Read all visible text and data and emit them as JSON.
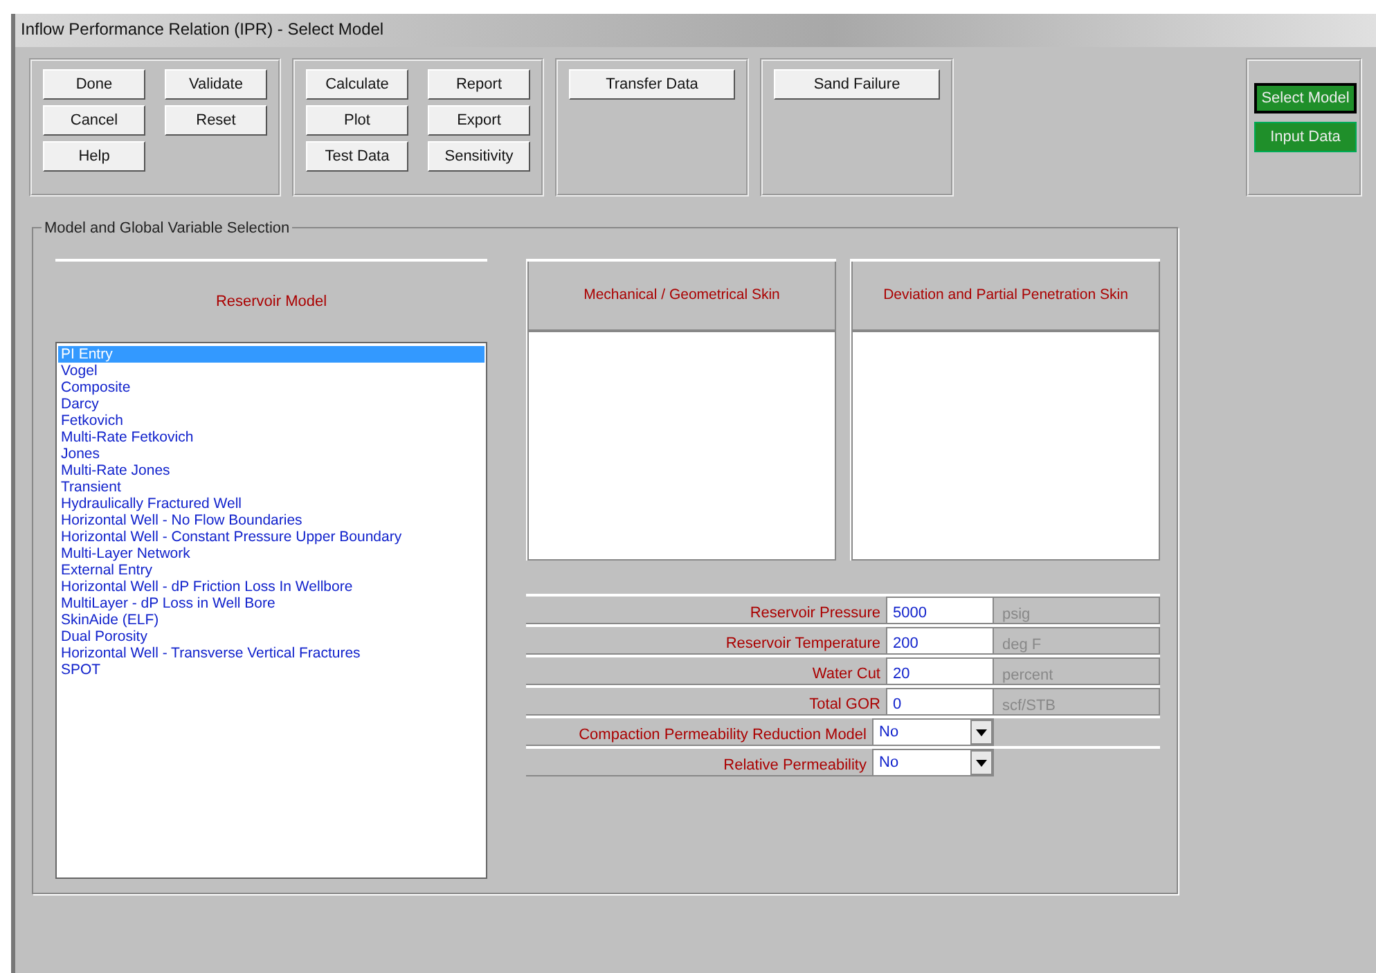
{
  "window": {
    "title": "Inflow Performance Relation (IPR) - Select Model"
  },
  "toolbar_groups": [
    {
      "buttons": [
        "Done",
        "Validate",
        "Cancel",
        "Reset",
        "Help"
      ]
    },
    {
      "buttons": [
        "Calculate",
        "Report",
        "Plot",
        "Export",
        "Test Data",
        "Sensitivity"
      ]
    },
    {
      "buttons": [
        "Transfer Data"
      ]
    },
    {
      "buttons": [
        "Sand Failure"
      ]
    }
  ],
  "nav_buttons": [
    {
      "label": "Select Model",
      "selected": true
    },
    {
      "label": "Input Data",
      "selected": false
    }
  ],
  "group": {
    "title": "Model and Global Variable Selection",
    "reservoir_model": {
      "heading": "Reservoir Model",
      "items": [
        {
          "label": "PI Entry",
          "selected": true
        },
        {
          "label": "Vogel",
          "selected": false
        },
        {
          "label": "Composite",
          "selected": false
        },
        {
          "label": "Darcy",
          "selected": false
        },
        {
          "label": "Fetkovich",
          "selected": false
        },
        {
          "label": "Multi-Rate Fetkovich",
          "selected": false
        },
        {
          "label": "Jones",
          "selected": false
        },
        {
          "label": "Multi-Rate Jones",
          "selected": false
        },
        {
          "label": "Transient",
          "selected": false
        },
        {
          "label": "Hydraulically Fractured Well",
          "selected": false
        },
        {
          "label": "Horizontal Well - No Flow Boundaries",
          "selected": false
        },
        {
          "label": "Horizontal Well - Constant Pressure Upper Boundary",
          "selected": false
        },
        {
          "label": "Multi-Layer Network",
          "selected": false
        },
        {
          "label": "External Entry",
          "selected": false
        },
        {
          "label": "Horizontal Well - dP Friction Loss In Wellbore",
          "selected": false
        },
        {
          "label": "MultiLayer - dP Loss in Well Bore",
          "selected": false
        },
        {
          "label": "SkinAide (ELF)",
          "selected": false
        },
        {
          "label": "Dual Porosity",
          "selected": false
        },
        {
          "label": "Horizontal Well - Transverse Vertical Fractures",
          "selected": false
        },
        {
          "label": "SPOT",
          "selected": false
        }
      ]
    },
    "skin_panels": [
      {
        "heading": "Mechanical / Geometrical Skin"
      },
      {
        "heading": "Deviation and Partial Penetration Skin"
      }
    ],
    "fields": [
      {
        "kind": "text",
        "label": "Reservoir Pressure",
        "value": "5000",
        "unit": "psig"
      },
      {
        "kind": "text",
        "label": "Reservoir Temperature",
        "value": "200",
        "unit": "deg F"
      },
      {
        "kind": "text",
        "label": "Water Cut",
        "value": "20",
        "unit": "percent"
      },
      {
        "kind": "text",
        "label": "Total GOR",
        "value": "0",
        "unit": "scf/STB"
      },
      {
        "kind": "select",
        "label": "Compaction Permeability Reduction Model",
        "value": "No"
      },
      {
        "kind": "select",
        "label": "Relative Permeability",
        "value": "No"
      }
    ]
  }
}
